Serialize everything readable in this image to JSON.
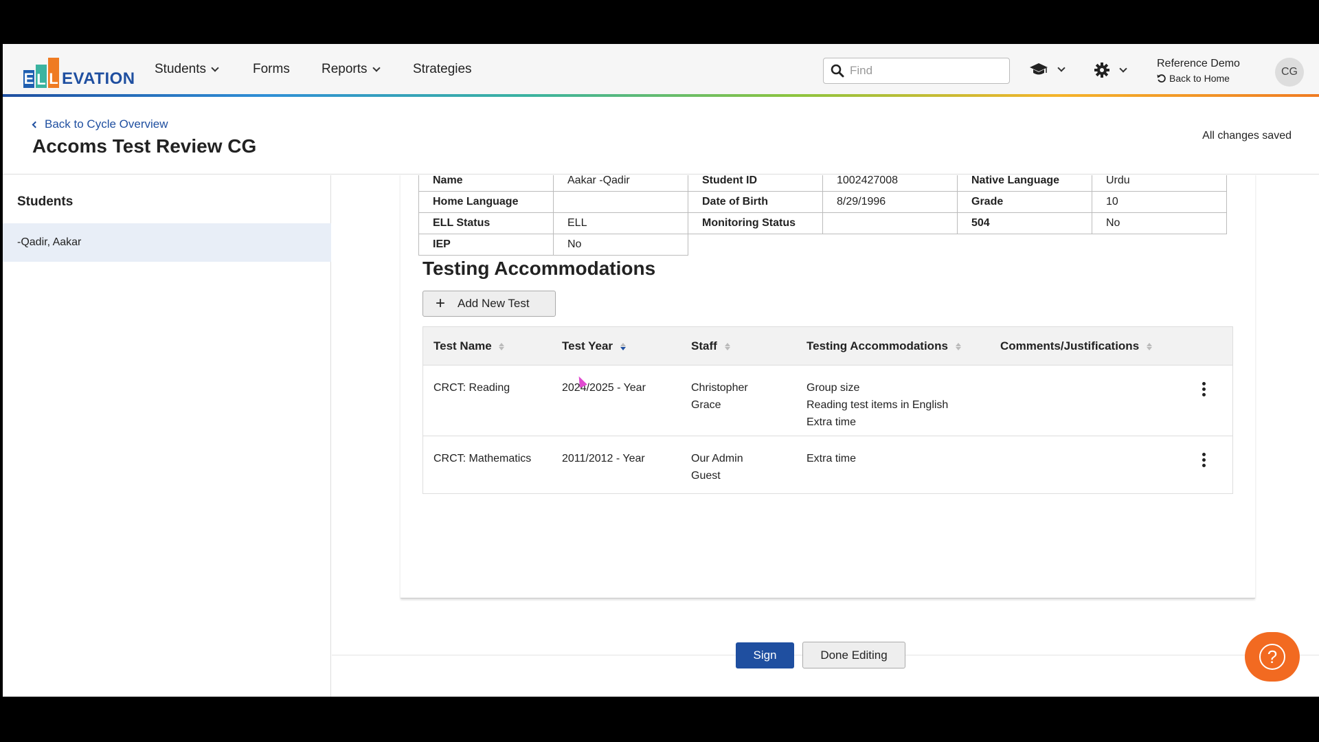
{
  "nav": {
    "logo_letters": [
      "E",
      "L",
      "L"
    ],
    "logo_rest": "EVATION",
    "items": [
      {
        "label": "Students",
        "has_menu": true
      },
      {
        "label": "Forms",
        "has_menu": false
      },
      {
        "label": "Reports",
        "has_menu": true
      },
      {
        "label": "Strategies",
        "has_menu": false
      }
    ],
    "search_placeholder": "Find",
    "school_icon": "graduation-cap-icon",
    "settings_icon": "gear-icon",
    "user_name": "Reference Demo",
    "back_home": "Back to Home",
    "avatar_initials": "CG"
  },
  "header": {
    "back_link": "Back to Cycle Overview",
    "title": "Accoms Test Review CG",
    "save_status": "All changes saved"
  },
  "sidebar": {
    "title": "Students",
    "students": [
      "-Qadir, Aakar"
    ]
  },
  "student_info": {
    "rows": [
      [
        {
          "label": "Name",
          "value": "Aakar -Qadir"
        },
        {
          "label": "Student ID",
          "value": "1002427008"
        },
        {
          "label": "Native Language",
          "value": "Urdu"
        }
      ],
      [
        {
          "label": "Home Language",
          "value": ""
        },
        {
          "label": "Date of Birth",
          "value": "8/29/1996"
        },
        {
          "label": "Grade",
          "value": "10"
        }
      ],
      [
        {
          "label": "ELL Status",
          "value": "ELL"
        },
        {
          "label": "Monitoring Status",
          "value": ""
        },
        {
          "label": "504",
          "value": "No"
        }
      ],
      [
        {
          "label": "IEP",
          "value": "No"
        }
      ]
    ]
  },
  "testing": {
    "title": "Testing Accommodations",
    "add_button": "Add New Test",
    "columns": [
      "Test Name",
      "Test Year",
      "Staff",
      "Testing Accommodations",
      "Comments/Justifications"
    ],
    "rows": [
      {
        "test_name": "CRCT: Reading",
        "test_year": "2024/2025 - Year",
        "staff": [
          "Christopher",
          "Grace"
        ],
        "accommodations": [
          "Group size",
          "Reading test items in English",
          "Extra time"
        ],
        "comments": ""
      },
      {
        "test_name": "CRCT: Mathematics",
        "test_year": "2011/2012 - Year",
        "staff": [
          "Our Admin",
          "Guest"
        ],
        "accommodations": [
          "Extra time"
        ],
        "comments": ""
      }
    ]
  },
  "footer": {
    "sign_button": "Sign",
    "done_button": "Done Editing"
  },
  "colors": {
    "brand_blue": "#1f4fa0",
    "help_orange": "#f26a21",
    "selected_row": "#e8eef7"
  }
}
